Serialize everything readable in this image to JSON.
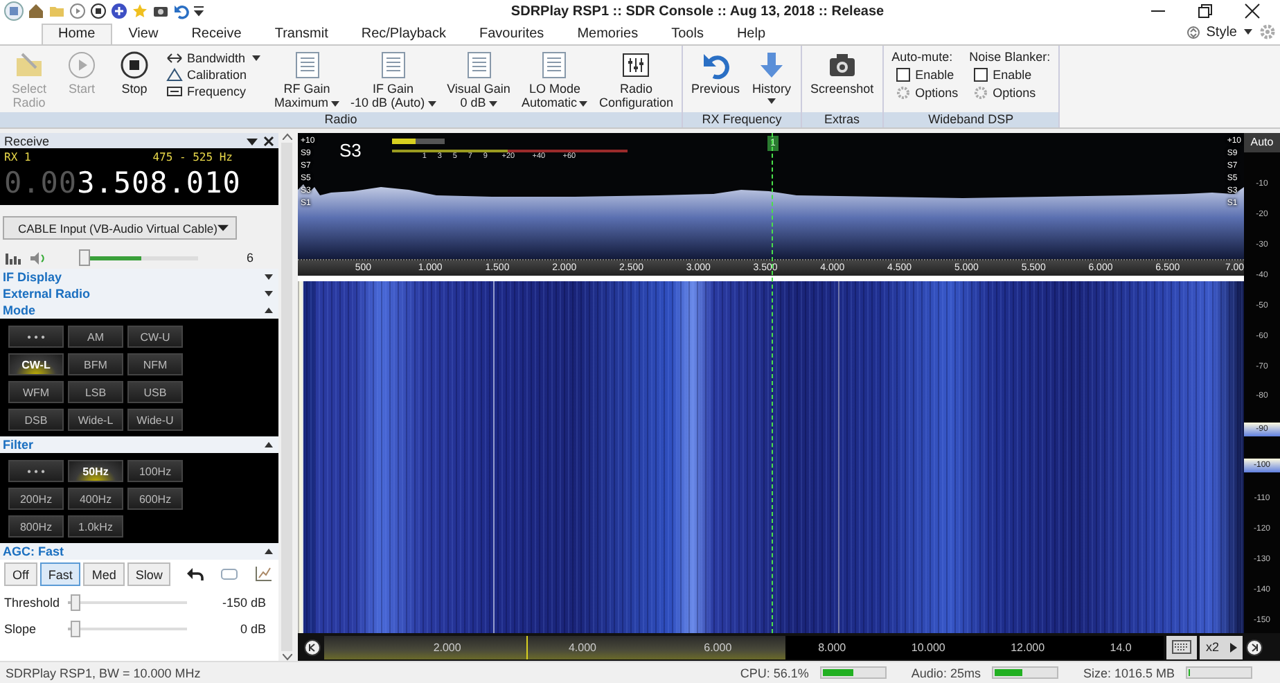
{
  "title_bar": {
    "title": "SDRPlay RSP1 :: SDR Console :: Aug 13, 2018 :: Release"
  },
  "menu_tabs": [
    {
      "label": "Home",
      "selected": true
    },
    {
      "label": "View",
      "selected": false
    },
    {
      "label": "Receive",
      "selected": false
    },
    {
      "label": "Transmit",
      "selected": false
    },
    {
      "label": "Rec/Playback",
      "selected": false
    },
    {
      "label": "Favourites",
      "selected": false
    },
    {
      "label": "Memories",
      "selected": false
    },
    {
      "label": "Tools",
      "selected": false
    },
    {
      "label": "Help",
      "selected": false
    }
  ],
  "style_menu": "Style",
  "ribbon": [
    {
      "title": "Radio",
      "items": [
        {
          "kind": "select",
          "lines": [
            "Select",
            "Radio"
          ],
          "disabled": true,
          "dropdown": false
        },
        {
          "kind": "start",
          "lines": [
            "Start"
          ],
          "disabled": true,
          "dropdown": false
        },
        {
          "kind": "stop",
          "lines": [
            "Stop"
          ],
          "disabled": false,
          "dropdown": false
        },
        {
          "kind": "stack",
          "entries": [
            {
              "label": "Bandwidth",
              "dropdown": true
            },
            {
              "label": "Calibration",
              "dropdown": false
            },
            {
              "label": "Frequency",
              "dropdown": false
            }
          ]
        },
        {
          "kind": "gain",
          "lines": [
            "RF Gain",
            "Maximum"
          ],
          "disabled": false,
          "dropdown": true
        },
        {
          "kind": "gain",
          "lines": [
            "IF Gain",
            "-10 dB (Auto)"
          ],
          "disabled": false,
          "dropdown": true
        },
        {
          "kind": "gain",
          "lines": [
            "Visual Gain",
            "0 dB"
          ],
          "disabled": false,
          "dropdown": true
        },
        {
          "kind": "gain",
          "lines": [
            "LO Mode",
            "Automatic"
          ],
          "disabled": false,
          "dropdown": true
        },
        {
          "kind": "config",
          "lines": [
            "Radio",
            "Configuration"
          ],
          "disabled": false,
          "dropdown": false
        }
      ]
    },
    {
      "title": "RX Frequency",
      "items": [
        {
          "kind": "previous",
          "lines": [
            "Previous"
          ],
          "disabled": false,
          "dropdown": false
        },
        {
          "kind": "history",
          "lines": [
            "History"
          ],
          "disabled": false,
          "dropdown": true
        }
      ]
    },
    {
      "title": "Extras",
      "items": [
        {
          "kind": "screenshot",
          "lines": [
            "Screenshot"
          ],
          "disabled": false,
          "dropdown": false
        }
      ]
    },
    {
      "title": "Wideband DSP",
      "items": [
        {
          "kind": "checks",
          "title": "Auto-mute:",
          "enable": {
            "label": "Enable",
            "checked": false
          },
          "options": "Options"
        },
        {
          "kind": "checks",
          "title": "Noise Blanker:",
          "enable": {
            "label": "Enable",
            "checked": false
          },
          "options": "Options"
        }
      ]
    }
  ],
  "receive_panel": {
    "title": "Receive",
    "rx_label": "RX 1",
    "filter_range": "475 - 525 Hz",
    "frequency_dim": "0.00",
    "frequency": "3.508.010",
    "audio_device": "CABLE Input (VB-Audio Virtual Cable)",
    "volume": {
      "level": 0.52,
      "reading": "6"
    },
    "sections": [
      {
        "title": "IF Display",
        "expanded": false
      },
      {
        "title": "External Radio",
        "expanded": false
      }
    ],
    "mode": {
      "title": "Mode",
      "expanded": true,
      "buttons": [
        {
          "label": "• • •",
          "selected": false
        },
        {
          "label": "AM",
          "selected": false
        },
        {
          "label": "CW-U",
          "selected": false
        },
        {
          "label": "CW-L",
          "selected": true
        },
        {
          "label": "BFM",
          "selected": false
        },
        {
          "label": "NFM",
          "selected": false
        },
        {
          "label": "WFM",
          "selected": false
        },
        {
          "label": "LSB",
          "selected": false
        },
        {
          "label": "USB",
          "selected": false
        },
        {
          "label": "DSB",
          "selected": false
        },
        {
          "label": "Wide-L",
          "selected": false
        },
        {
          "label": "Wide-U",
          "selected": false
        }
      ]
    },
    "filter": {
      "title": "Filter",
      "expanded": true,
      "buttons": [
        {
          "label": "• • •",
          "selected": false
        },
        {
          "label": "50Hz",
          "selected": true
        },
        {
          "label": "100Hz",
          "selected": false
        },
        {
          "label": "200Hz",
          "selected": false
        },
        {
          "label": "400Hz",
          "selected": false
        },
        {
          "label": "600Hz",
          "selected": false
        },
        {
          "label": "800Hz",
          "selected": false
        },
        {
          "label": "1.0kHz",
          "selected": false
        }
      ]
    },
    "agc": {
      "title": "AGC: Fast",
      "expanded": true,
      "modes": [
        {
          "label": "Off",
          "selected": false
        },
        {
          "label": "Fast",
          "selected": true
        },
        {
          "label": "Med",
          "selected": false
        },
        {
          "label": "Slow",
          "selected": false
        }
      ],
      "sliders": [
        {
          "label": "Threshold",
          "level": 0.02,
          "reading": "-150 dB"
        },
        {
          "label": "Slope",
          "level": 0.02,
          "reading": "0 dB"
        }
      ]
    }
  },
  "spectrum": {
    "s_meter": {
      "reading": "S3",
      "level": 0.45,
      "scale": [
        "1",
        "3",
        "5",
        "7",
        "9",
        "+20",
        "+40",
        "+60"
      ]
    },
    "scale_left": [
      "+10",
      "S9",
      "S7",
      "S5",
      "S3",
      "S1"
    ],
    "scale_right": [
      "+10",
      "S9",
      "S7",
      "S5",
      "S3",
      "S1"
    ],
    "marker": "1",
    "freq_axis": [
      "500",
      "1.000",
      "1.500",
      "2.000",
      "2.500",
      "3.000",
      "3.500",
      "4.000",
      "4.500",
      "5.000",
      "5.500",
      "6.000",
      "6.500",
      "7.00"
    ]
  },
  "level_scale": {
    "mode": "Auto",
    "labels": [
      {
        "label": "-10",
        "highlighted": false
      },
      {
        "label": "-20",
        "highlighted": false
      },
      {
        "label": "-30",
        "highlighted": false
      },
      {
        "label": "-40",
        "highlighted": false
      },
      {
        "label": "-50",
        "highlighted": false
      },
      {
        "label": "-60",
        "highlighted": false
      },
      {
        "label": "-70",
        "highlighted": false
      },
      {
        "label": "-80",
        "highlighted": false
      },
      {
        "label": "-90",
        "highlighted": true
      },
      {
        "label": "-100",
        "highlighted": true
      },
      {
        "label": "-110",
        "highlighted": false
      },
      {
        "label": "-120",
        "highlighted": false
      },
      {
        "label": "-130",
        "highlighted": false
      },
      {
        "label": "-140",
        "highlighted": false
      },
      {
        "label": "-150",
        "highlighted": false
      }
    ]
  },
  "overview": {
    "labels": [
      {
        "label": "2.000",
        "in_view": true
      },
      {
        "label": "4.000",
        "in_view": true
      },
      {
        "label": "6.000",
        "in_view": true
      },
      {
        "label": "8.000",
        "in_view": false
      },
      {
        "label": "10.000",
        "in_view": false
      },
      {
        "label": "12.000",
        "in_view": false
      },
      {
        "label": "14.0",
        "in_view": false
      }
    ],
    "zoom": "x2"
  },
  "status_bar": {
    "text": "SDRPlay RSP1, BW = 10.000 MHz",
    "meters": [
      {
        "label": "CPU: 56.1%",
        "level": 0.5
      },
      {
        "label": "Audio: 25ms",
        "level": 0.45
      },
      {
        "label": "Size: 1016.5 MB",
        "level": 0.03
      }
    ]
  }
}
